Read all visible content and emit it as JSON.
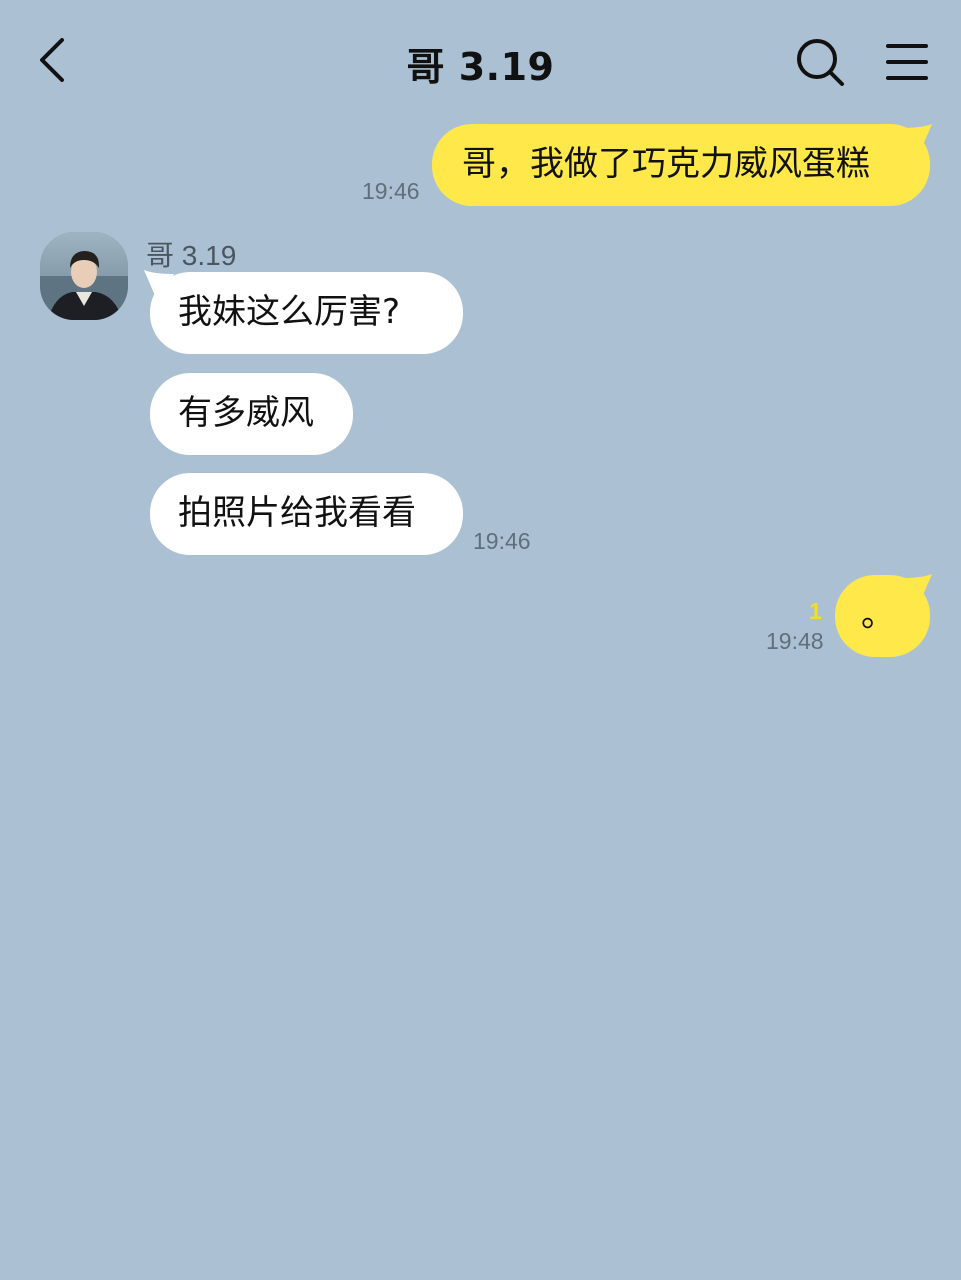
{
  "header": {
    "title": "哥 3.19",
    "back_icon": "chevron-left-icon",
    "search_icon": "search-icon",
    "menu_icon": "hamburger-menu-icon"
  },
  "contact": {
    "name": "哥 3.19",
    "avatar": "profile-photo"
  },
  "messages": [
    {
      "from": "me",
      "text": "哥，我做了巧克力威风蛋糕",
      "time": "19:46"
    },
    {
      "from": "other",
      "text": "我妹这么厉害?"
    },
    {
      "from": "other",
      "text": "有多威风"
    },
    {
      "from": "other",
      "text": "拍照片给我看看",
      "time": "19:46"
    },
    {
      "from": "me",
      "text": "。",
      "time": "19:48",
      "unread": "1"
    }
  ],
  "colors": {
    "background": "#abc1d3",
    "my_bubble": "#fee84a",
    "other_bubble": "#ffffff",
    "unread_count": "#f1dd2c"
  }
}
